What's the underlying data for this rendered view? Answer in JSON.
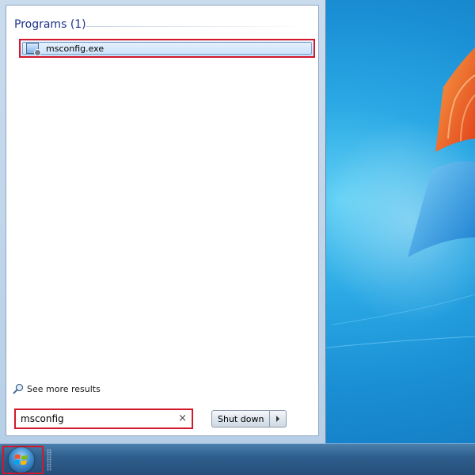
{
  "start_menu": {
    "group_header": "Programs (1)",
    "results": [
      {
        "label": "msconfig.exe",
        "icon": "msconfig-program-icon"
      }
    ],
    "see_more": "See more results",
    "search": {
      "value": "msconfig",
      "clear_glyph": "×"
    },
    "shutdown": {
      "label": "Shut down"
    }
  },
  "taskbar": {
    "start_icon": "windows-orb-icon"
  },
  "colors": {
    "highlight_box": "#d2182b",
    "header_text": "#1e3287",
    "desktop_blue": "#1a8ed4"
  }
}
